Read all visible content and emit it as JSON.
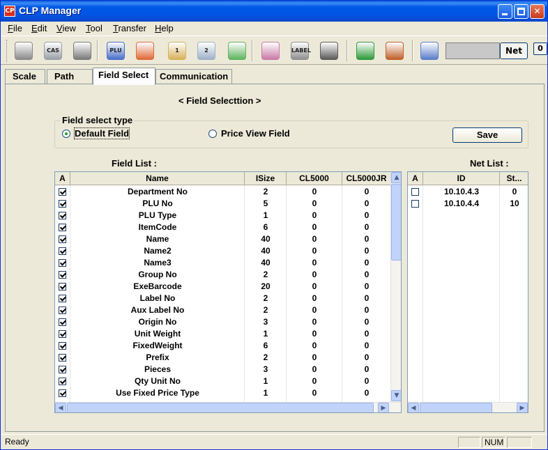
{
  "window": {
    "title": "CLP Manager"
  },
  "menu": [
    {
      "accel": "F",
      "rest": "ile"
    },
    {
      "accel": "E",
      "rest": "dit"
    },
    {
      "accel": "V",
      "rest": "iew"
    },
    {
      "accel": "T",
      "rest": "ool"
    },
    {
      "accel": "T",
      "rest": "ransfer"
    },
    {
      "accel": "H",
      "rest": "elp"
    }
  ],
  "toolbar": {
    "tools": [
      {
        "name": "open-folder-icon",
        "color": "#8a8a8a",
        "label": ""
      },
      {
        "name": "save-disk-icon",
        "color": "#9aa0a8",
        "label": "CAS"
      },
      {
        "name": "print-icon",
        "color": "#7a7a7a",
        "label": ""
      },
      {
        "name": "plu-icon",
        "color": "#4a6fc9",
        "label": "PLU"
      },
      {
        "name": "star-icon",
        "color": "#e06a3a",
        "label": ""
      },
      {
        "name": "scale-1-icon",
        "color": "#d6b25a",
        "label": "1"
      },
      {
        "name": "scale-2-icon",
        "color": "#9fb1c9",
        "label": "2"
      },
      {
        "name": "people-icon",
        "color": "#5fb35f",
        "label": ""
      },
      {
        "name": "settings-sheet-icon",
        "color": "#c97aa8",
        "label": ""
      },
      {
        "name": "label-icon",
        "color": "#8f8f8f",
        "label": "LABEL"
      },
      {
        "name": "keyboard-icon",
        "color": "#5a5a5a",
        "label": ""
      },
      {
        "name": "send-arrow-icon",
        "color": "#2f9a3a",
        "label": ""
      },
      {
        "name": "receive-arrow-icon",
        "color": "#c0602a",
        "label": ""
      },
      {
        "name": "tools-icon",
        "color": "#5a7ec9",
        "label": ""
      }
    ],
    "net_label": "Net",
    "zero_label": "0"
  },
  "tabs": [
    "Scale",
    "Path",
    "Field Select",
    "Communication"
  ],
  "panel": {
    "heading": "< Field Selecttion >",
    "group_title": "Field select type",
    "radio_default": "Default Field",
    "radio_price": "Price View Field",
    "save_label": "Save",
    "field_list_title": "Field List :",
    "net_list_title": "Net List :"
  },
  "field_grid": {
    "columns": [
      "A",
      "Name",
      "ISize",
      "CL5000",
      "CL5000JR"
    ],
    "rows": [
      [
        "Department No",
        "2",
        "0",
        "0"
      ],
      [
        "PLU No",
        "5",
        "0",
        "0"
      ],
      [
        "PLU Type",
        "1",
        "0",
        "0"
      ],
      [
        "ItemCode",
        "6",
        "0",
        "0"
      ],
      [
        "Name",
        "40",
        "0",
        "0"
      ],
      [
        "Name2",
        "40",
        "0",
        "0"
      ],
      [
        "Name3",
        "40",
        "0",
        "0"
      ],
      [
        "Group No",
        "2",
        "0",
        "0"
      ],
      [
        "ExeBarcode",
        "20",
        "0",
        "0"
      ],
      [
        "Label No",
        "2",
        "0",
        "0"
      ],
      [
        "Aux Label No",
        "2",
        "0",
        "0"
      ],
      [
        "Origin No",
        "3",
        "0",
        "0"
      ],
      [
        "Unit Weight",
        "1",
        "0",
        "0"
      ],
      [
        "FixedWeight",
        "6",
        "0",
        "0"
      ],
      [
        "Prefix",
        "2",
        "0",
        "0"
      ],
      [
        "Pieces",
        "3",
        "0",
        "0"
      ],
      [
        "Qty Unit No",
        "1",
        "0",
        "0"
      ],
      [
        "Use Fixed Price Type",
        "1",
        "0",
        "0"
      ]
    ]
  },
  "net_grid": {
    "columns": [
      "A",
      "ID",
      "St..."
    ],
    "rows": [
      [
        "10.10.4.3",
        "0"
      ],
      [
        "10.10.4.4",
        "10"
      ]
    ]
  },
  "status": {
    "text": "Ready",
    "num": "NUM"
  }
}
